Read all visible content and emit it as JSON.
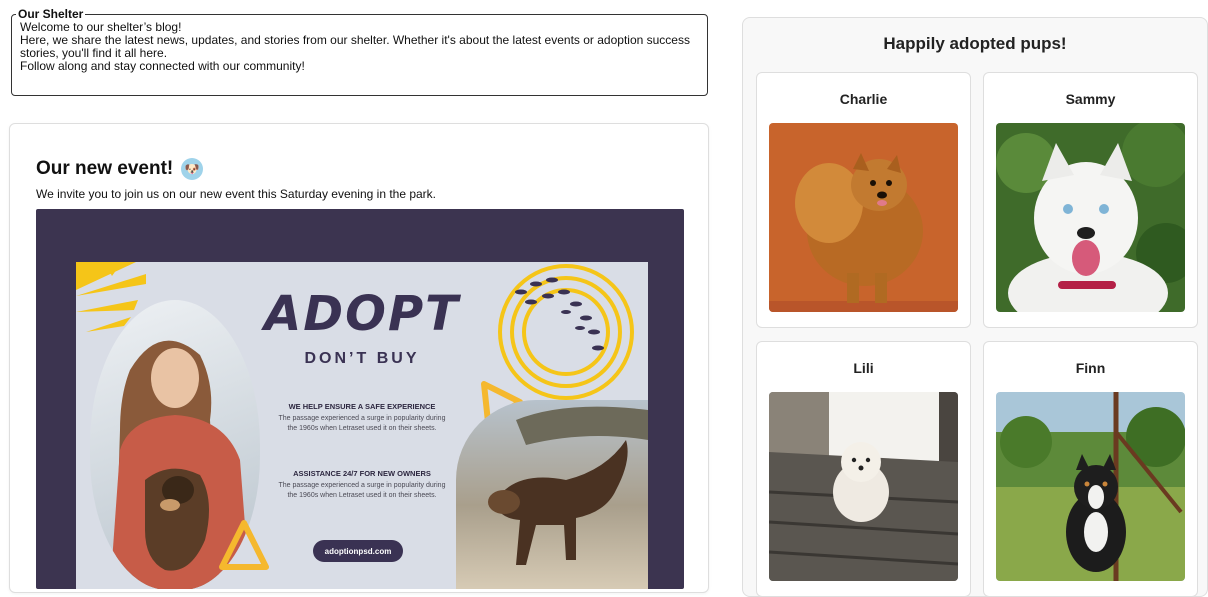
{
  "shelter": {
    "legend": "Our Shelter",
    "lines": [
      "Welcome to our shelter’s blog!",
      "Here, we share the latest news, updates, and stories from our shelter. Whether it's about the latest events or adoption success stories, you'll find it all here.",
      "Follow along and stay connected with our community!"
    ]
  },
  "event": {
    "title": "Our new event!",
    "title_emoji": "🐶",
    "description": "We invite you to join us on our new event this Saturday evening in the park.",
    "poster": {
      "headline": "ADOPT",
      "subheadline": "DON’T BUY",
      "section1_title": "WE HELP ENSURE A SAFE EXPERIENCE",
      "section1_text": "The passage experienced a surge in popularity during the 1960s when Letraset used it on their sheets.",
      "section2_title": "ASSISTANCE 24/7 FOR NEW OWNERS",
      "section2_text": "The passage experienced a surge in popularity during the 1960s when Letraset used it on their sheets.",
      "url": "adoptionpsd.com"
    }
  },
  "pups": {
    "title": "Happily adopted pups!",
    "items": [
      {
        "name": "Charlie",
        "photo": "pomeranian-photo"
      },
      {
        "name": "Sammy",
        "photo": "husky-photo"
      },
      {
        "name": "Lili",
        "photo": "white-fluffy-dog-photo"
      },
      {
        "name": "Finn",
        "photo": "australian-shepherd-photo"
      }
    ]
  },
  "colors": {
    "poster_frame": "#3c3450",
    "poster_bg": "#d9dde6",
    "poster_accent": "#f5c518",
    "poster_text": "#3a3253",
    "panel_bg": "#f8f8f8"
  }
}
